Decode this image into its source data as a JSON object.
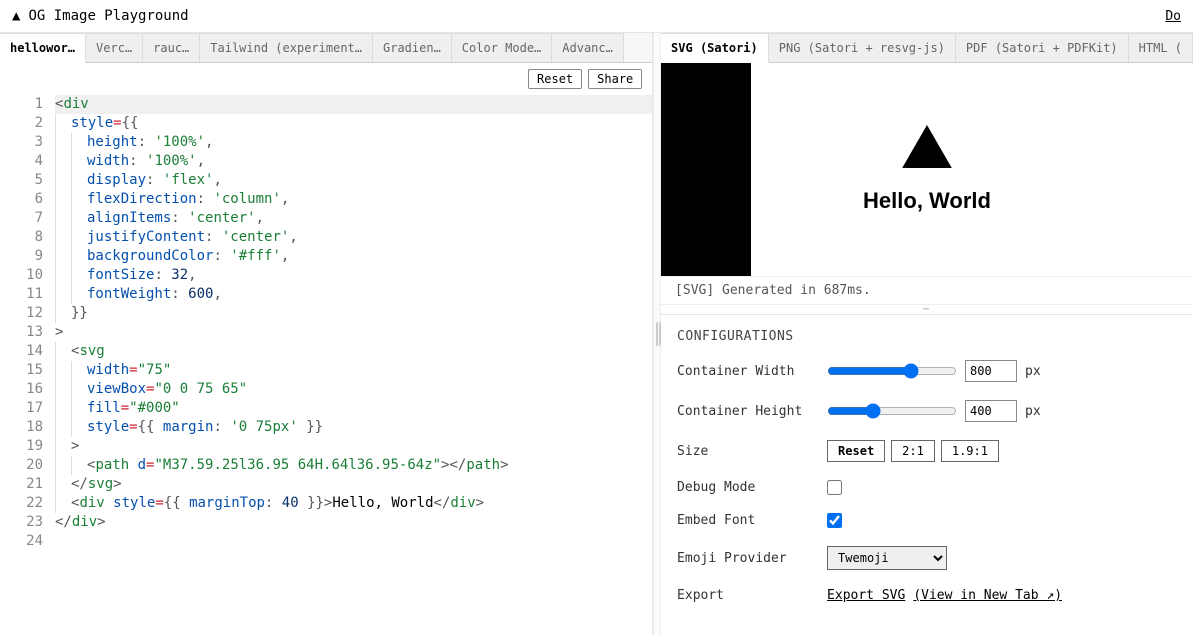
{
  "header": {
    "title": "OG Image Playground",
    "right": "Do"
  },
  "leftTabs": [
    "hellowor…",
    "Verc…",
    "rauc…",
    "Tailwind (experiment…",
    "Gradien…",
    "Color Mode…",
    "Advanc…"
  ],
  "editorButtons": {
    "reset": "Reset",
    "share": "Share"
  },
  "code": [
    {
      "indent": 0,
      "tokens": [
        [
          "punct",
          "<"
        ],
        [
          "tag",
          "div"
        ]
      ]
    },
    {
      "indent": 1,
      "tokens": [
        [
          "prop",
          "style"
        ],
        [
          "op",
          "="
        ],
        [
          "punct",
          "{{"
        ]
      ]
    },
    {
      "indent": 2,
      "tokens": [
        [
          "prop",
          "height"
        ],
        [
          "punct",
          ": "
        ],
        [
          "str",
          "'100%'"
        ],
        [
          "punct",
          ","
        ]
      ]
    },
    {
      "indent": 2,
      "tokens": [
        [
          "prop",
          "width"
        ],
        [
          "punct",
          ": "
        ],
        [
          "str",
          "'100%'"
        ],
        [
          "punct",
          ","
        ]
      ]
    },
    {
      "indent": 2,
      "tokens": [
        [
          "prop",
          "display"
        ],
        [
          "punct",
          ": "
        ],
        [
          "str",
          "'flex'"
        ],
        [
          "punct",
          ","
        ]
      ]
    },
    {
      "indent": 2,
      "tokens": [
        [
          "prop",
          "flexDirection"
        ],
        [
          "punct",
          ": "
        ],
        [
          "str",
          "'column'"
        ],
        [
          "punct",
          ","
        ]
      ]
    },
    {
      "indent": 2,
      "tokens": [
        [
          "prop",
          "alignItems"
        ],
        [
          "punct",
          ": "
        ],
        [
          "str",
          "'center'"
        ],
        [
          "punct",
          ","
        ]
      ]
    },
    {
      "indent": 2,
      "tokens": [
        [
          "prop",
          "justifyContent"
        ],
        [
          "punct",
          ": "
        ],
        [
          "str",
          "'center'"
        ],
        [
          "punct",
          ","
        ]
      ]
    },
    {
      "indent": 2,
      "tokens": [
        [
          "prop",
          "backgroundColor"
        ],
        [
          "punct",
          ": "
        ],
        [
          "str",
          "'#fff'"
        ],
        [
          "punct",
          ","
        ]
      ]
    },
    {
      "indent": 2,
      "tokens": [
        [
          "prop",
          "fontSize"
        ],
        [
          "punct",
          ": "
        ],
        [
          "num",
          "32"
        ],
        [
          "punct",
          ","
        ]
      ]
    },
    {
      "indent": 2,
      "tokens": [
        [
          "prop",
          "fontWeight"
        ],
        [
          "punct",
          ": "
        ],
        [
          "num",
          "600"
        ],
        [
          "punct",
          ","
        ]
      ]
    },
    {
      "indent": 1,
      "tokens": [
        [
          "punct",
          "}}"
        ]
      ]
    },
    {
      "indent": 0,
      "tokens": [
        [
          "punct",
          ">"
        ]
      ]
    },
    {
      "indent": 1,
      "tokens": [
        [
          "punct",
          "<"
        ],
        [
          "tag",
          "svg"
        ]
      ]
    },
    {
      "indent": 2,
      "tokens": [
        [
          "prop",
          "width"
        ],
        [
          "op",
          "="
        ],
        [
          "str",
          "\"75\""
        ]
      ]
    },
    {
      "indent": 2,
      "tokens": [
        [
          "prop",
          "viewBox"
        ],
        [
          "op",
          "="
        ],
        [
          "str",
          "\"0 0 75 65\""
        ]
      ]
    },
    {
      "indent": 2,
      "tokens": [
        [
          "prop",
          "fill"
        ],
        [
          "op",
          "="
        ],
        [
          "str",
          "\"#000\""
        ]
      ]
    },
    {
      "indent": 2,
      "tokens": [
        [
          "prop",
          "style"
        ],
        [
          "op",
          "="
        ],
        [
          "punct",
          "{{ "
        ],
        [
          "prop",
          "margin"
        ],
        [
          "punct",
          ": "
        ],
        [
          "str",
          "'0 75px'"
        ],
        [
          "punct",
          " }}"
        ]
      ]
    },
    {
      "indent": 1,
      "tokens": [
        [
          "punct",
          ">"
        ]
      ]
    },
    {
      "indent": 2,
      "tokens": [
        [
          "punct",
          "<"
        ],
        [
          "tag",
          "path"
        ],
        [
          "punct",
          " "
        ],
        [
          "prop",
          "d"
        ],
        [
          "op",
          "="
        ],
        [
          "str",
          "\"M37.59.25l36.95 64H.64l36.95-64z\""
        ],
        [
          "punct",
          "></"
        ],
        [
          "tag",
          "path"
        ],
        [
          "punct",
          ">"
        ]
      ]
    },
    {
      "indent": 1,
      "tokens": [
        [
          "punct",
          "</"
        ],
        [
          "tag",
          "svg"
        ],
        [
          "punct",
          ">"
        ]
      ]
    },
    {
      "indent": 1,
      "tokens": [
        [
          "punct",
          "<"
        ],
        [
          "tag",
          "div"
        ],
        [
          "punct",
          " "
        ],
        [
          "prop",
          "style"
        ],
        [
          "op",
          "="
        ],
        [
          "punct",
          "{{ "
        ],
        [
          "prop",
          "marginTop"
        ],
        [
          "punct",
          ": "
        ],
        [
          "num",
          "40"
        ],
        [
          "punct",
          " }}>"
        ],
        [
          "text",
          "Hello, World"
        ],
        [
          "punct",
          "</"
        ],
        [
          "tag",
          "div"
        ],
        [
          "punct",
          ">"
        ]
      ]
    },
    {
      "indent": 0,
      "tokens": [
        [
          "punct",
          "</"
        ],
        [
          "tag",
          "div"
        ],
        [
          "punct",
          ">"
        ]
      ]
    },
    {
      "indent": 0,
      "tokens": []
    }
  ],
  "rightTabs": [
    "SVG (Satori)",
    "PNG (Satori + resvg-js)",
    "PDF (Satori + PDFKit)",
    "HTML ("
  ],
  "preview": {
    "text": "Hello, World"
  },
  "status": "[SVG] Generated in 687ms.",
  "config": {
    "title": "CONFIGURATIONS",
    "widthLabel": "Container Width",
    "widthValue": "800",
    "widthUnit": "px",
    "heightLabel": "Container Height",
    "heightValue": "400",
    "heightUnit": "px",
    "sizeLabel": "Size",
    "sizeReset": "Reset",
    "ratio1": "2:1",
    "ratio2": "1.9:1",
    "debugLabel": "Debug Mode",
    "debugChecked": false,
    "embedLabel": "Embed Font",
    "embedChecked": true,
    "emojiLabel": "Emoji Provider",
    "emojiValue": "Twemoji",
    "exportLabel": "Export",
    "exportLink": "Export SVG",
    "exportView": "(View in New Tab ↗)"
  }
}
